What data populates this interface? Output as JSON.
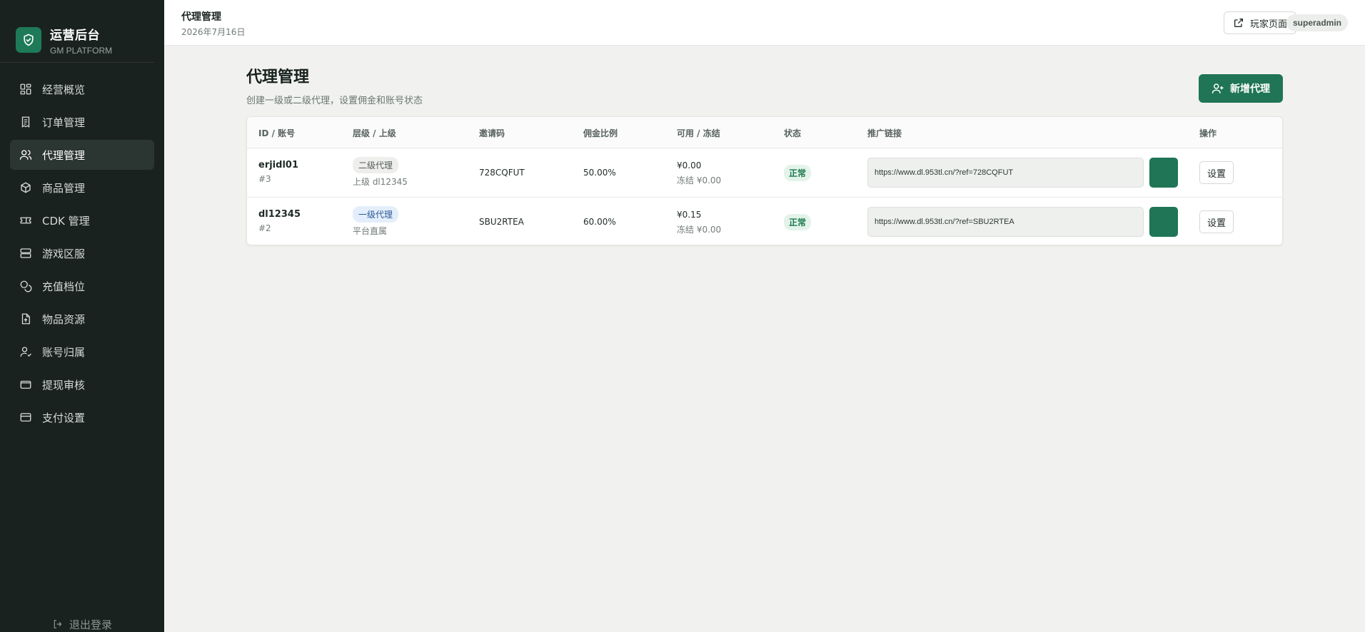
{
  "sidebar": {
    "brand_title": "运营后台",
    "brand_sub": "GM PLATFORM",
    "items": [
      {
        "label": "经营概览",
        "icon": "dashboard-icon"
      },
      {
        "label": "订单管理",
        "icon": "receipt-icon"
      },
      {
        "label": "代理管理",
        "icon": "users-icon",
        "active": true
      },
      {
        "label": "商品管理",
        "icon": "package-icon"
      },
      {
        "label": "CDK 管理",
        "icon": "ticket-icon"
      },
      {
        "label": "游戏区服",
        "icon": "server-icon"
      },
      {
        "label": "充值档位",
        "icon": "coins-icon"
      },
      {
        "label": "物品资源",
        "icon": "file-upload-icon"
      },
      {
        "label": "账号归属",
        "icon": "user-check-icon"
      },
      {
        "label": "提现审核",
        "icon": "wallet-icon"
      },
      {
        "label": "支付设置",
        "icon": "credit-card-icon"
      }
    ],
    "logout": "退出登录"
  },
  "topbar": {
    "title": "代理管理",
    "date": "2026年7月16日",
    "player_page": "玩家页面",
    "user": "superadmin"
  },
  "page": {
    "title": "代理管理",
    "desc": "创建一级或二级代理，设置佣金和账号状态",
    "add_button": "新增代理"
  },
  "table": {
    "headers": [
      "ID / 账号",
      "层级 / 上级",
      "邀请码",
      "佣金比例",
      "可用 / 冻结",
      "状态",
      "推广链接",
      "操作"
    ],
    "rows": [
      {
        "account": "erjidl01",
        "id": "#3",
        "level": "二级代理",
        "parent": "上级 dl12345",
        "invite": "728CQFUT",
        "commission": "50.00%",
        "available": "¥0.00",
        "frozen": "冻结 ¥0.00",
        "status": "正常",
        "link": "https://www.dl.953tl.cn/?ref=728CQFUT",
        "action": "设置"
      },
      {
        "account": "dl12345",
        "id": "#2",
        "level": "一级代理",
        "parent": "平台直属",
        "invite": "SBU2RTEA",
        "commission": "60.00%",
        "available": "¥0.15",
        "frozen": "冻结 ¥0.00",
        "status": "正常",
        "link": "https://www.dl.953tl.cn/?ref=SBU2RTEA",
        "action": "设置"
      }
    ]
  },
  "colors": {
    "sidebar_bg": "#1a2220",
    "accent": "#1f7556",
    "status_ok": "#1b7a4e"
  }
}
